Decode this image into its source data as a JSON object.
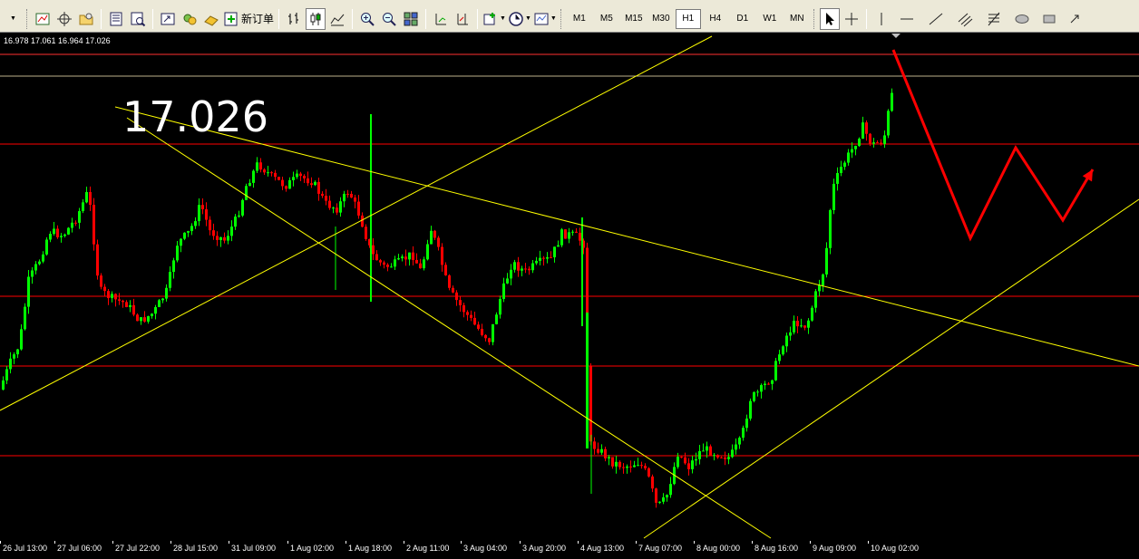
{
  "toolbar": {
    "new_order_label": "新订单",
    "timeframes": [
      "M1",
      "M5",
      "M15",
      "M30",
      "H1",
      "H4",
      "D1",
      "W1",
      "MN"
    ],
    "active_timeframe": "H1"
  },
  "chart": {
    "ohlc_text": "16.978 17.061 16.964 17.026",
    "price_annotation": "17.026",
    "x_labels": [
      "26 Jul 13:00",
      "27 Jul 06:00",
      "27 Jul 22:00",
      "28 Jul 15:00",
      "31 Jul 09:00",
      "1 Aug 02:00",
      "1 Aug 18:00",
      "2 Aug 11:00",
      "3 Aug 04:00",
      "3 Aug 20:00",
      "4 Aug 13:00",
      "7 Aug 07:00",
      "8 Aug 00:00",
      "8 Aug 16:00",
      "9 Aug 09:00",
      "10 Aug 02:00"
    ],
    "colors": {
      "background": "#000000",
      "bull_candle": "#00ff00",
      "bear_candle": "#ff0000",
      "horizontal_level": "#ff0000",
      "trendline": "#ffff00",
      "forecast_arrow": "#ff0000"
    }
  }
}
